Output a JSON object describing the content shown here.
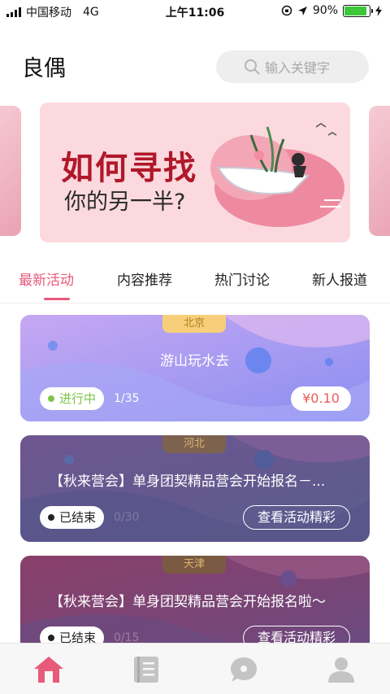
{
  "status_bar": {
    "carrier": "中国移动",
    "network": "4G",
    "time": "上午11:06",
    "battery": "90%",
    "battery_level": 0.9
  },
  "header": {
    "title": "良偶",
    "search_placeholder": "输入关键字",
    "search_icon": "search-icon"
  },
  "banner": {
    "line1": "如何寻找",
    "line2": "你的另一半?"
  },
  "tabs": [
    {
      "label": "最新活动",
      "active": true
    },
    {
      "label": "内容推荐",
      "active": false
    },
    {
      "label": "热门讨论",
      "active": false
    },
    {
      "label": "新人报道",
      "active": false
    }
  ],
  "activities": [
    {
      "city": "北京",
      "title": "游山玩水去",
      "status": "进行中",
      "count": "1/35",
      "price": "¥0.10",
      "action": ""
    },
    {
      "city": "河北",
      "title": "【秋来营会】单身团契精品营会开始报名－...",
      "status": "已结束",
      "count": "0/30",
      "price": "",
      "action": "查看活动精彩"
    },
    {
      "city": "天津",
      "title": "【秋来营会】单身团契精品营会开始报名啦～",
      "status": "已结束",
      "count": "0/15",
      "price": "",
      "action": "查看活动精彩"
    }
  ],
  "bottom_nav": [
    {
      "icon": "home-icon",
      "active": true
    },
    {
      "icon": "notebook-icon",
      "active": false
    },
    {
      "icon": "chat-bubble-icon",
      "active": false
    },
    {
      "icon": "person-icon",
      "active": false
    }
  ],
  "colors": {
    "accent": "#e85a7a",
    "price": "#ef5a5a",
    "active_green": "#7cc44a"
  }
}
